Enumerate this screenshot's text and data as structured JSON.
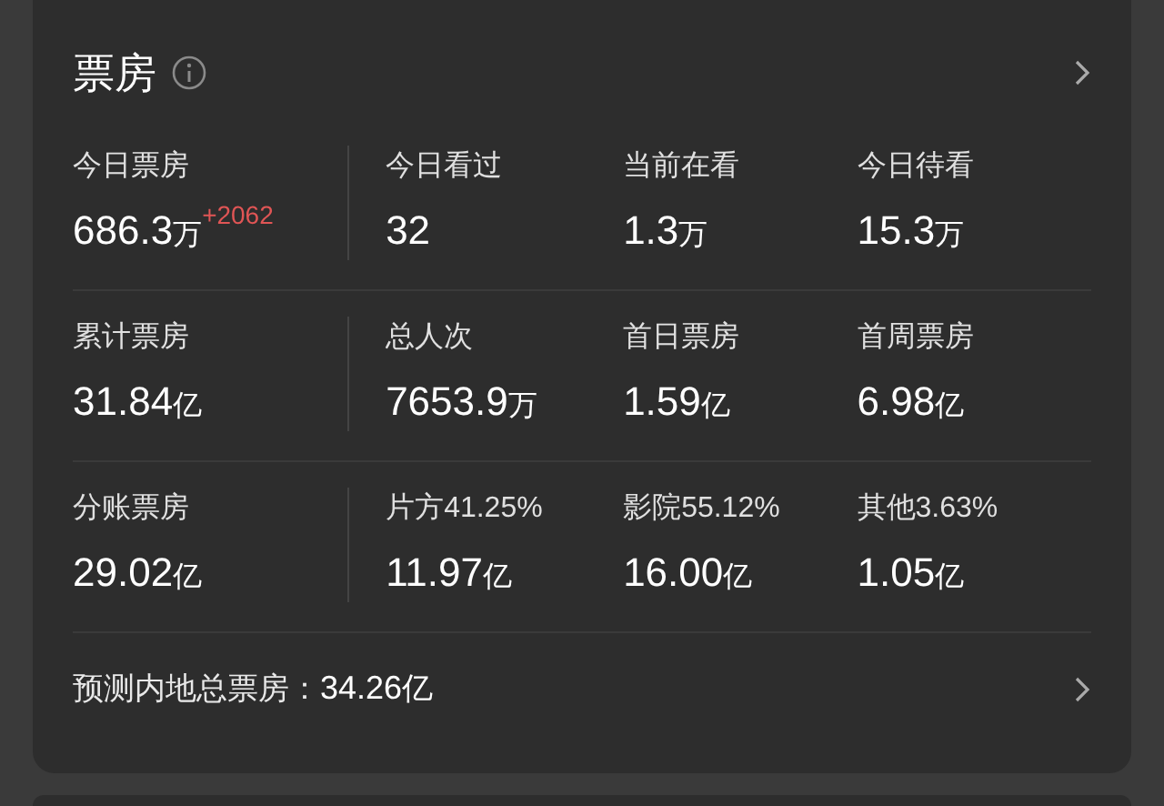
{
  "card": {
    "title": "票房",
    "rows": [
      {
        "cells": [
          {
            "label": "今日票房",
            "number": "686.3",
            "unit": "万",
            "delta": "+2062"
          },
          {
            "label": "今日看过",
            "number": "32"
          },
          {
            "label": "当前在看",
            "number": "1.3",
            "unit": "万"
          },
          {
            "label": "今日待看",
            "number": "15.3",
            "unit": "万"
          }
        ]
      },
      {
        "cells": [
          {
            "label": "累计票房",
            "number": "31.84",
            "unit": "亿"
          },
          {
            "label": "总人次",
            "number": "7653.9",
            "unit": "万"
          },
          {
            "label": "首日票房",
            "number": "1.59",
            "unit": "亿"
          },
          {
            "label": "首周票房",
            "number": "6.98",
            "unit": "亿"
          }
        ]
      },
      {
        "cells": [
          {
            "label": "分账票房",
            "number": "29.02",
            "unit": "亿"
          },
          {
            "label": "片方41.25%",
            "number": "11.97",
            "unit": "亿"
          },
          {
            "label": "影院55.12%",
            "number": "16.00",
            "unit": "亿"
          },
          {
            "label": "其他3.63%",
            "number": "1.05",
            "unit": "亿"
          }
        ]
      }
    ],
    "forecast": {
      "label": "预测内地总票房：",
      "number": "34.26",
      "unit": "亿"
    }
  }
}
